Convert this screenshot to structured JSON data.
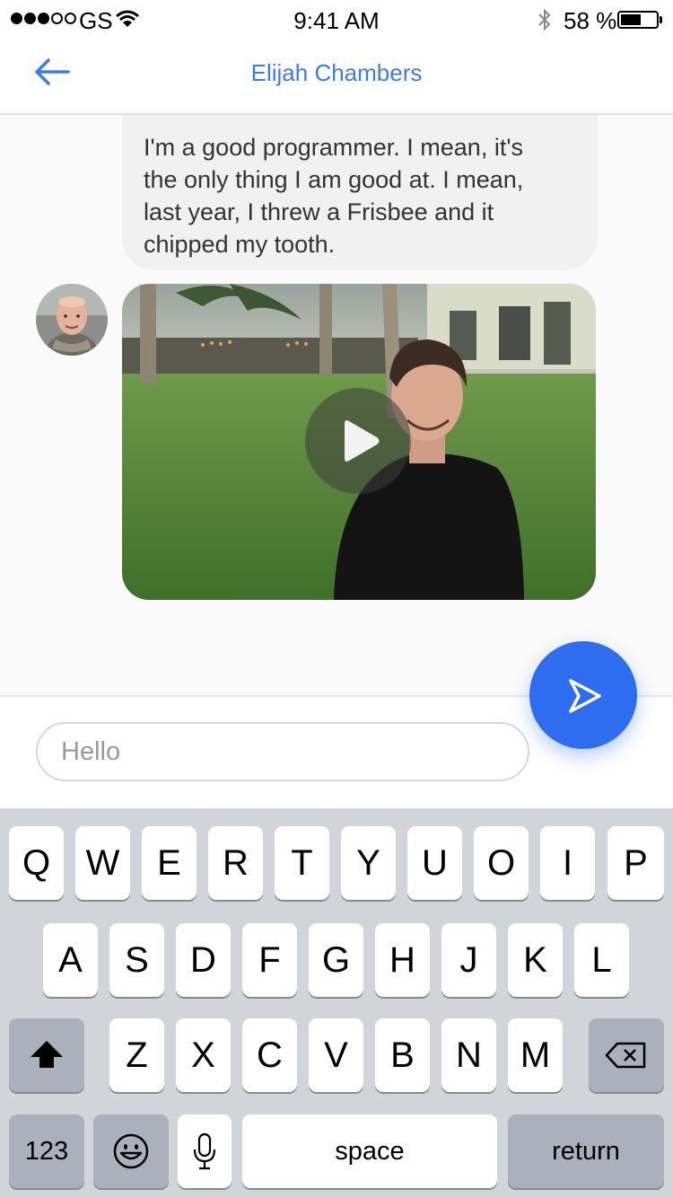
{
  "status_bar": {
    "signal_dots_filled": 3,
    "signal_dots_total": 5,
    "carrier": "GS",
    "time": "9:41 AM",
    "battery": "58 %",
    "battery_level": 0.58
  },
  "nav": {
    "back_icon": "arrow-left-icon",
    "title": "Elijah Chambers"
  },
  "messages": [
    {
      "type": "text",
      "lines": [
        "I'm a good programmer. I mean, it's",
        "the only thing I am good at. I mean,",
        "last year, I threw a Frisbee and it",
        "chipped my tooth."
      ]
    },
    {
      "type": "video",
      "play_icon": "play-icon"
    }
  ],
  "composer": {
    "placeholder": "Hello",
    "send_icon": "send-icon"
  },
  "keyboard": {
    "row1": [
      "Q",
      "W",
      "E",
      "R",
      "T",
      "Y",
      "U",
      "O",
      "I",
      "P"
    ],
    "row2": [
      "A",
      "S",
      "D",
      "F",
      "G",
      "H",
      "J",
      "K",
      "L"
    ],
    "row3": [
      "Z",
      "X",
      "C",
      "V",
      "B",
      "N",
      "M"
    ],
    "numbers_key": "123",
    "space_key": "space",
    "return_key": "return"
  },
  "colors": {
    "accent": "#3d7be6",
    "send_button": "#2e6cf0",
    "bubble": "#f1f1f1",
    "keyboard_bg": "#d1d4d9"
  }
}
